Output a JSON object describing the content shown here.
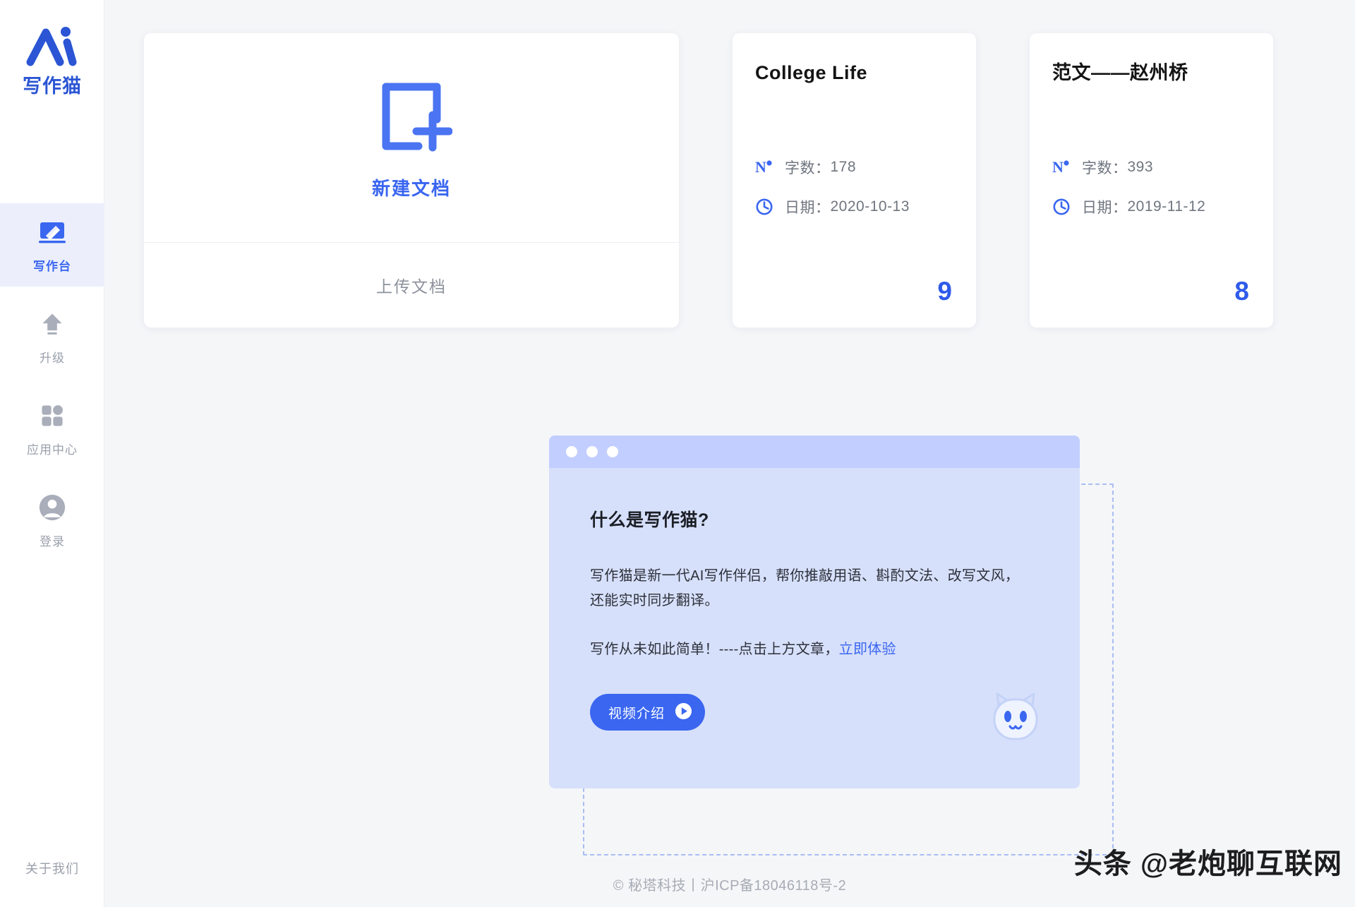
{
  "brand": {
    "logo_icon": "ai-cat-logo-icon",
    "name": "写作猫"
  },
  "sidebar": {
    "items": [
      {
        "id": "writing-desk",
        "label": "写作台",
        "icon": "pencil-board-icon",
        "active": true
      },
      {
        "id": "upgrade",
        "label": "升级",
        "icon": "upload-arrow-icon",
        "active": false
      },
      {
        "id": "app-center",
        "label": "应用中心",
        "icon": "grid-apps-icon",
        "active": false
      },
      {
        "id": "login",
        "label": "登录",
        "icon": "user-avatar-icon",
        "active": false
      }
    ],
    "about": "关于我们"
  },
  "new_document": {
    "icon": "document-plus-icon",
    "create_label": "新建文档",
    "upload_label": "上传文档"
  },
  "documents": [
    {
      "title": "College Life",
      "words_label": "字数：",
      "words_value": "178",
      "date_label": "日期：",
      "date_value": "2020-10-13",
      "words_icon": "number-sign-icon",
      "date_icon": "clock-icon",
      "badge": "9"
    },
    {
      "title": "范文——赵州桥",
      "words_label": "字数：",
      "words_value": "393",
      "date_label": "日期：",
      "date_value": "2019-11-12",
      "words_icon": "number-sign-icon",
      "date_icon": "clock-icon",
      "badge": "8"
    }
  ],
  "promo": {
    "heading": "什么是写作猫?",
    "description": "写作猫是新一代AI写作伴侣，帮你推敲用语、斟酌文法、改写文风，还能实时同步翻译。",
    "cta_prefix": "写作从未如此简单！----点击上方文章，",
    "cta_link": "立即体验",
    "video_button_label": "视频介绍",
    "video_button_icon": "play-circle-icon",
    "mascot_icon": "cat-face-icon",
    "window_dots": 3
  },
  "footer": {
    "copyright": "© 秘塔科技丨",
    "icp": "沪ICP备18046118号-2"
  },
  "watermark": {
    "text": "头条 @老炮聊互联网"
  },
  "colors": {
    "accent": "#3a66f0",
    "accent_deep": "#2b55d4",
    "badge": "#2f5bea",
    "panel_bg": "#d7e0fb",
    "panel_titlebar": "#c2ceff",
    "sidebar_active_bg": "#eceffb",
    "muted_text": "#9aa0ab",
    "page_bg": "#f5f6f8"
  }
}
